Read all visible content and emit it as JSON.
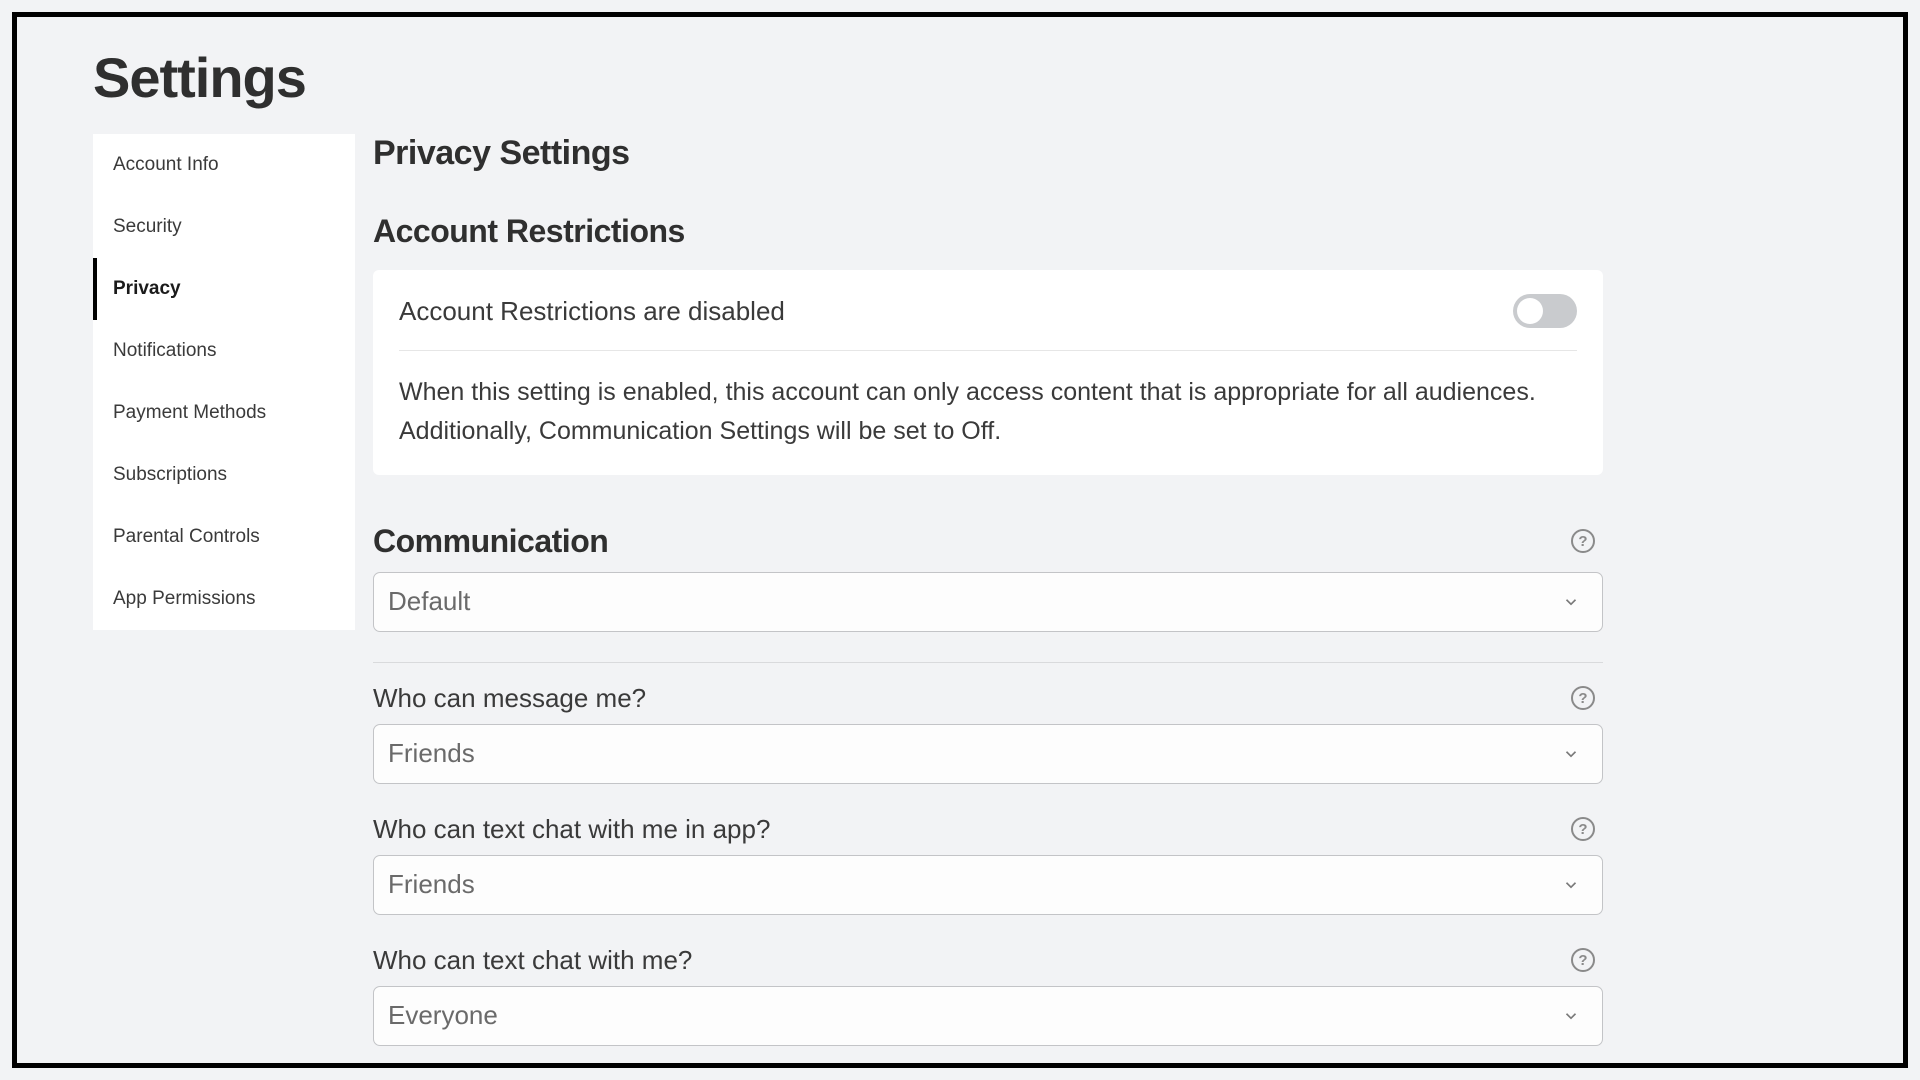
{
  "page_title": "Settings",
  "sidebar": {
    "items": [
      {
        "label": "Account Info"
      },
      {
        "label": "Security"
      },
      {
        "label": "Privacy"
      },
      {
        "label": "Notifications"
      },
      {
        "label": "Payment Methods"
      },
      {
        "label": "Subscriptions"
      },
      {
        "label": "Parental Controls"
      },
      {
        "label": "App Permissions"
      }
    ],
    "active_index": 2
  },
  "main": {
    "heading": "Privacy Settings",
    "restrictions": {
      "heading": "Account Restrictions",
      "status_text": "Account Restrictions are disabled",
      "description": "When this setting is enabled, this account can only access content that is appropriate for all audiences. Additionally, Communication Settings will be set to Off."
    },
    "communication": {
      "heading": "Communication",
      "main_value": "Default",
      "fields": [
        {
          "label": "Who can message me?",
          "value": "Friends"
        },
        {
          "label": "Who can text chat with me in app?",
          "value": "Friends"
        },
        {
          "label": "Who can text chat with me?",
          "value": "Everyone"
        }
      ]
    }
  }
}
